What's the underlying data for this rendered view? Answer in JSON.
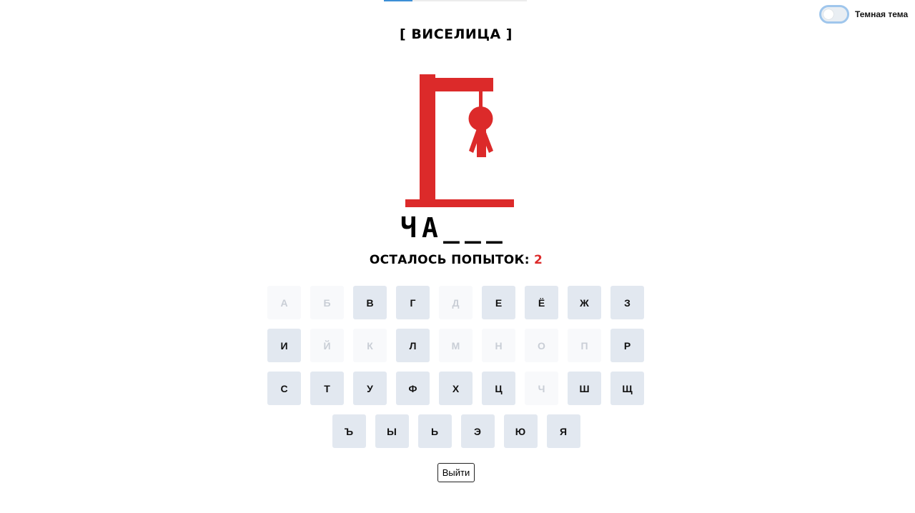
{
  "theme_toggle": {
    "label": "Темная тема",
    "enabled": false
  },
  "title": "[ ВИСЕЛИЦА ]",
  "hangman_color": "#dc2a2a",
  "word": [
    "Ч",
    "А",
    "_",
    "_",
    "_"
  ],
  "attempts": {
    "label": "ОСТАЛОСЬ ПОПЫТОК:",
    "count": "2"
  },
  "keyboard": {
    "rows": [
      [
        {
          "l": "А",
          "d": true
        },
        {
          "l": "Б",
          "d": true
        },
        {
          "l": "В",
          "d": false
        },
        {
          "l": "Г",
          "d": false
        },
        {
          "l": "Д",
          "d": true
        },
        {
          "l": "Е",
          "d": false
        },
        {
          "l": "Ё",
          "d": false
        },
        {
          "l": "Ж",
          "d": false
        },
        {
          "l": "З",
          "d": false
        }
      ],
      [
        {
          "l": "И",
          "d": false
        },
        {
          "l": "Й",
          "d": true
        },
        {
          "l": "К",
          "d": true
        },
        {
          "l": "Л",
          "d": false
        },
        {
          "l": "М",
          "d": true
        },
        {
          "l": "Н",
          "d": true
        },
        {
          "l": "О",
          "d": true
        },
        {
          "l": "П",
          "d": true
        },
        {
          "l": "Р",
          "d": false
        }
      ],
      [
        {
          "l": "С",
          "d": false
        },
        {
          "l": "Т",
          "d": false
        },
        {
          "l": "У",
          "d": false
        },
        {
          "l": "Ф",
          "d": false
        },
        {
          "l": "Х",
          "d": false
        },
        {
          "l": "Ц",
          "d": false
        },
        {
          "l": "Ч",
          "d": true
        },
        {
          "l": "Ш",
          "d": false
        },
        {
          "l": "Щ",
          "d": false
        }
      ],
      [
        {
          "l": "Ъ",
          "d": false
        },
        {
          "l": "Ы",
          "d": false
        },
        {
          "l": "Ь",
          "d": false
        },
        {
          "l": "Э",
          "d": false
        },
        {
          "l": "Ю",
          "d": false
        },
        {
          "l": "Я",
          "d": false
        }
      ]
    ]
  },
  "exit_label": "Выйти"
}
